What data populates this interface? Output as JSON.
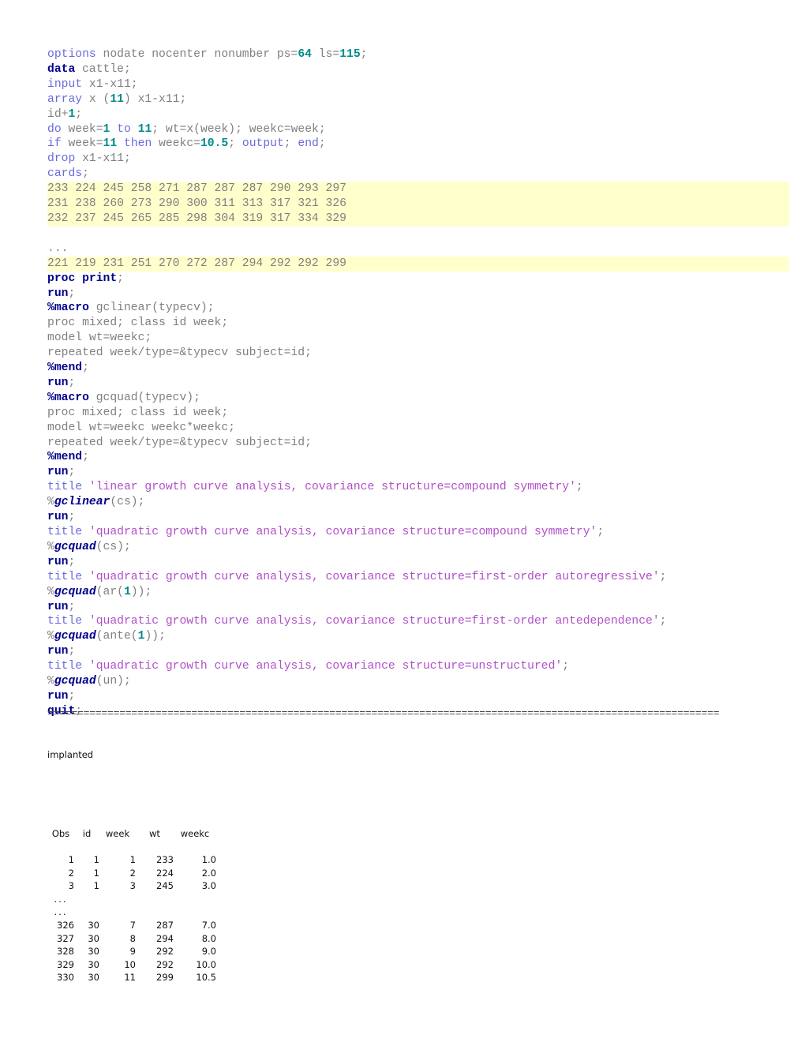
{
  "document": {
    "kind": "sas-program-listing",
    "colors": {
      "keyword_blue": "#6a6ae0",
      "keyword_navy": "#00008b",
      "number_teal": "#008b8b",
      "string_purple": "#b050c8",
      "identifier_gray": "#808080",
      "data_highlight_bg": "#ffffcc"
    }
  },
  "code": {
    "lines": [
      {
        "id": "l01",
        "highlight": false,
        "tokens": [
          {
            "t": "options",
            "c": "kw-blue"
          },
          {
            "t": " nodate nocenter nonumber ps=",
            "c": "plain"
          },
          {
            "t": "64",
            "c": "num"
          },
          {
            "t": " ls=",
            "c": "plain"
          },
          {
            "t": "115",
            "c": "num"
          },
          {
            "t": ";",
            "c": "plain"
          }
        ]
      },
      {
        "id": "l02",
        "highlight": false,
        "tokens": [
          {
            "t": "data",
            "c": "kw-navy"
          },
          {
            "t": " cattle;",
            "c": "plain"
          }
        ]
      },
      {
        "id": "l03",
        "highlight": false,
        "tokens": [
          {
            "t": "input",
            "c": "kw-blue"
          },
          {
            "t": " x1-x11;",
            "c": "plain"
          }
        ]
      },
      {
        "id": "l04",
        "highlight": false,
        "tokens": [
          {
            "t": "array",
            "c": "kw-blue"
          },
          {
            "t": " x (",
            "c": "plain"
          },
          {
            "t": "11",
            "c": "num"
          },
          {
            "t": ") x1-x11;",
            "c": "plain"
          }
        ]
      },
      {
        "id": "l05",
        "highlight": false,
        "tokens": [
          {
            "t": "id+",
            "c": "plain"
          },
          {
            "t": "1",
            "c": "num"
          },
          {
            "t": ";",
            "c": "plain"
          }
        ]
      },
      {
        "id": "l06",
        "highlight": false,
        "tokens": [
          {
            "t": "do",
            "c": "kw-blue"
          },
          {
            "t": " week=",
            "c": "plain"
          },
          {
            "t": "1",
            "c": "num"
          },
          {
            "t": " ",
            "c": "plain"
          },
          {
            "t": "to",
            "c": "kw-blue"
          },
          {
            "t": " ",
            "c": "plain"
          },
          {
            "t": "11",
            "c": "num"
          },
          {
            "t": "; wt=x(week); weekc=week;",
            "c": "plain"
          }
        ]
      },
      {
        "id": "l07",
        "highlight": false,
        "tokens": [
          {
            "t": "if",
            "c": "kw-blue"
          },
          {
            "t": " week=",
            "c": "plain"
          },
          {
            "t": "11",
            "c": "num"
          },
          {
            "t": " ",
            "c": "plain"
          },
          {
            "t": "then",
            "c": "kw-blue"
          },
          {
            "t": " weekc=",
            "c": "plain"
          },
          {
            "t": "10.5",
            "c": "num"
          },
          {
            "t": "; ",
            "c": "plain"
          },
          {
            "t": "output",
            "c": "kw-blue"
          },
          {
            "t": "; ",
            "c": "plain"
          },
          {
            "t": "end",
            "c": "kw-blue"
          },
          {
            "t": ";",
            "c": "plain"
          }
        ]
      },
      {
        "id": "l08",
        "highlight": false,
        "tokens": [
          {
            "t": "drop",
            "c": "kw-blue"
          },
          {
            "t": " x1-x11;",
            "c": "plain"
          }
        ]
      },
      {
        "id": "l09",
        "highlight": false,
        "tokens": [
          {
            "t": "cards",
            "c": "kw-blue"
          },
          {
            "t": ";",
            "c": "plain"
          }
        ]
      },
      {
        "id": "l10",
        "highlight": true,
        "tokens": [
          {
            "t": "233 224 245 258 271 287 287 287 290 293 297",
            "c": "plain"
          }
        ]
      },
      {
        "id": "l11",
        "highlight": true,
        "tokens": [
          {
            "t": "231 238 260 273 290 300 311 313 317 321 326",
            "c": "plain"
          }
        ]
      },
      {
        "id": "l12",
        "highlight": true,
        "tokens": [
          {
            "t": "232 237 245 265 285 298 304 319 317 334 329",
            "c": "plain"
          }
        ]
      },
      {
        "id": "l13",
        "highlight": false,
        "tokens": [
          {
            "t": "",
            "c": "plain"
          }
        ]
      },
      {
        "id": "l14",
        "highlight": false,
        "tokens": [
          {
            "t": "...",
            "c": "plain"
          }
        ]
      },
      {
        "id": "l15",
        "highlight": true,
        "tokens": [
          {
            "t": "221 219 231 251 270 272 287 294 292 292 299",
            "c": "plain"
          }
        ]
      },
      {
        "id": "l16",
        "highlight": false,
        "tokens": [
          {
            "t": "proc print",
            "c": "kw-navy"
          },
          {
            "t": ";",
            "c": "plain"
          }
        ]
      },
      {
        "id": "l17",
        "highlight": false,
        "tokens": [
          {
            "t": "run",
            "c": "kw-navy"
          },
          {
            "t": ";",
            "c": "plain"
          }
        ]
      },
      {
        "id": "l18",
        "highlight": false,
        "tokens": [
          {
            "t": "%macro",
            "c": "kw-macro"
          },
          {
            "t": " gclinear(typecv);",
            "c": "plain"
          }
        ]
      },
      {
        "id": "l19",
        "highlight": false,
        "tokens": [
          {
            "t": "proc mixed; class id week;",
            "c": "plain"
          }
        ]
      },
      {
        "id": "l20",
        "highlight": false,
        "tokens": [
          {
            "t": "model wt=weekc;",
            "c": "plain"
          }
        ]
      },
      {
        "id": "l21",
        "highlight": false,
        "tokens": [
          {
            "t": "repeated week/type=&typecv subject=id;",
            "c": "plain"
          }
        ]
      },
      {
        "id": "l22",
        "highlight": false,
        "tokens": [
          {
            "t": "%mend",
            "c": "kw-macro"
          },
          {
            "t": ";",
            "c": "plain"
          }
        ]
      },
      {
        "id": "l23",
        "highlight": false,
        "tokens": [
          {
            "t": "run",
            "c": "kw-navy"
          },
          {
            "t": ";",
            "c": "plain"
          }
        ]
      },
      {
        "id": "l24",
        "highlight": false,
        "tokens": [
          {
            "t": "%macro",
            "c": "kw-macro"
          },
          {
            "t": " gcquad(typecv);",
            "c": "plain"
          }
        ]
      },
      {
        "id": "l25",
        "highlight": false,
        "tokens": [
          {
            "t": "proc mixed; class id week;",
            "c": "plain"
          }
        ]
      },
      {
        "id": "l26",
        "highlight": false,
        "tokens": [
          {
            "t": "model wt=weekc weekc*weekc;",
            "c": "plain"
          }
        ]
      },
      {
        "id": "l27",
        "highlight": false,
        "tokens": [
          {
            "t": "repeated week/type=&typecv subject=id;",
            "c": "plain"
          }
        ]
      },
      {
        "id": "l28",
        "highlight": false,
        "tokens": [
          {
            "t": "%mend",
            "c": "kw-macro"
          },
          {
            "t": ";",
            "c": "plain"
          }
        ]
      },
      {
        "id": "l29",
        "highlight": false,
        "tokens": [
          {
            "t": "run",
            "c": "kw-navy"
          },
          {
            "t": ";",
            "c": "plain"
          }
        ]
      },
      {
        "id": "l30",
        "highlight": false,
        "tokens": [
          {
            "t": "title",
            "c": "kw-blue"
          },
          {
            "t": " ",
            "c": "plain"
          },
          {
            "t": "'linear growth curve analysis, covariance structure=compound symmetry'",
            "c": "str"
          },
          {
            "t": ";",
            "c": "plain"
          }
        ]
      },
      {
        "id": "l31",
        "highlight": false,
        "tokens": [
          {
            "t": "%",
            "c": "plain"
          },
          {
            "t": "gclinear",
            "c": "mname"
          },
          {
            "t": "(cs);",
            "c": "plain"
          }
        ]
      },
      {
        "id": "l32",
        "highlight": false,
        "tokens": [
          {
            "t": "run",
            "c": "kw-navy"
          },
          {
            "t": ";",
            "c": "plain"
          }
        ]
      },
      {
        "id": "l33",
        "highlight": false,
        "tokens": [
          {
            "t": "title",
            "c": "kw-blue"
          },
          {
            "t": " ",
            "c": "plain"
          },
          {
            "t": "'quadratic growth curve analysis, covariance structure=compound symmetry'",
            "c": "str"
          },
          {
            "t": ";",
            "c": "plain"
          }
        ]
      },
      {
        "id": "l34",
        "highlight": false,
        "tokens": [
          {
            "t": "%",
            "c": "plain"
          },
          {
            "t": "gcquad",
            "c": "mname"
          },
          {
            "t": "(cs);",
            "c": "plain"
          }
        ]
      },
      {
        "id": "l35",
        "highlight": false,
        "tokens": [
          {
            "t": "run",
            "c": "kw-navy"
          },
          {
            "t": ";",
            "c": "plain"
          }
        ]
      },
      {
        "id": "l36",
        "highlight": false,
        "tokens": [
          {
            "t": "title",
            "c": "kw-blue"
          },
          {
            "t": " ",
            "c": "plain"
          },
          {
            "t": "'quadratic growth curve analysis, covariance structure=first-order autoregressive'",
            "c": "str"
          },
          {
            "t": ";",
            "c": "plain"
          }
        ]
      },
      {
        "id": "l37",
        "highlight": false,
        "tokens": [
          {
            "t": "%",
            "c": "plain"
          },
          {
            "t": "gcquad",
            "c": "mname"
          },
          {
            "t": "(ar(",
            "c": "plain"
          },
          {
            "t": "1",
            "c": "num"
          },
          {
            "t": "));",
            "c": "plain"
          }
        ]
      },
      {
        "id": "l38",
        "highlight": false,
        "tokens": [
          {
            "t": "run",
            "c": "kw-navy"
          },
          {
            "t": ";",
            "c": "plain"
          }
        ]
      },
      {
        "id": "l39",
        "highlight": false,
        "tokens": [
          {
            "t": "title",
            "c": "kw-blue"
          },
          {
            "t": " ",
            "c": "plain"
          },
          {
            "t": "'quadratic growth curve analysis, covariance structure=first-order antedependence'",
            "c": "str"
          },
          {
            "t": ";",
            "c": "plain"
          }
        ]
      },
      {
        "id": "l40",
        "highlight": false,
        "tokens": [
          {
            "t": "%",
            "c": "plain"
          },
          {
            "t": "gcquad",
            "c": "mname"
          },
          {
            "t": "(ante(",
            "c": "plain"
          },
          {
            "t": "1",
            "c": "num"
          },
          {
            "t": "));",
            "c": "plain"
          }
        ]
      },
      {
        "id": "l41",
        "highlight": false,
        "tokens": [
          {
            "t": "run",
            "c": "kw-navy"
          },
          {
            "t": ";",
            "c": "plain"
          }
        ]
      },
      {
        "id": "l42",
        "highlight": false,
        "tokens": [
          {
            "t": "title",
            "c": "kw-blue"
          },
          {
            "t": " ",
            "c": "plain"
          },
          {
            "t": "'quadratic growth curve analysis, covariance structure=unstructured'",
            "c": "str"
          },
          {
            "t": ";",
            "c": "plain"
          }
        ]
      },
      {
        "id": "l43",
        "highlight": false,
        "tokens": [
          {
            "t": "%",
            "c": "plain"
          },
          {
            "t": "gcquad",
            "c": "mname"
          },
          {
            "t": "(un);",
            "c": "plain"
          }
        ]
      },
      {
        "id": "l44",
        "highlight": false,
        "tokens": [
          {
            "t": "run",
            "c": "kw-navy"
          },
          {
            "t": ";",
            "c": "plain"
          }
        ]
      },
      {
        "id": "l45",
        "highlight": false,
        "tokens": [
          {
            "t": "quit",
            "c": "kw-navy"
          },
          {
            "t": ";",
            "c": "plain"
          }
        ]
      }
    ]
  },
  "separator": "================================================================================================================",
  "output": {
    "caption": "implanted",
    "columns": [
      "Obs",
      "id",
      "week",
      "wt",
      "weekc"
    ],
    "rows": [
      [
        "1",
        "1",
        "1",
        "233",
        "1.0"
      ],
      [
        "2",
        "1",
        "2",
        "224",
        "2.0"
      ],
      [
        "3",
        "1",
        "3",
        "245",
        "3.0"
      ],
      [
        "...",
        "",
        "",
        "",
        ""
      ],
      [
        "...",
        "",
        "",
        "",
        ""
      ],
      [
        "326",
        "30",
        "7",
        "287",
        "7.0"
      ],
      [
        "327",
        "30",
        "8",
        "294",
        "8.0"
      ],
      [
        "328",
        "30",
        "9",
        "292",
        "9.0"
      ],
      [
        "329",
        "30",
        "10",
        "292",
        "10.0"
      ],
      [
        "330",
        "30",
        "11",
        "299",
        "10.5"
      ]
    ]
  }
}
